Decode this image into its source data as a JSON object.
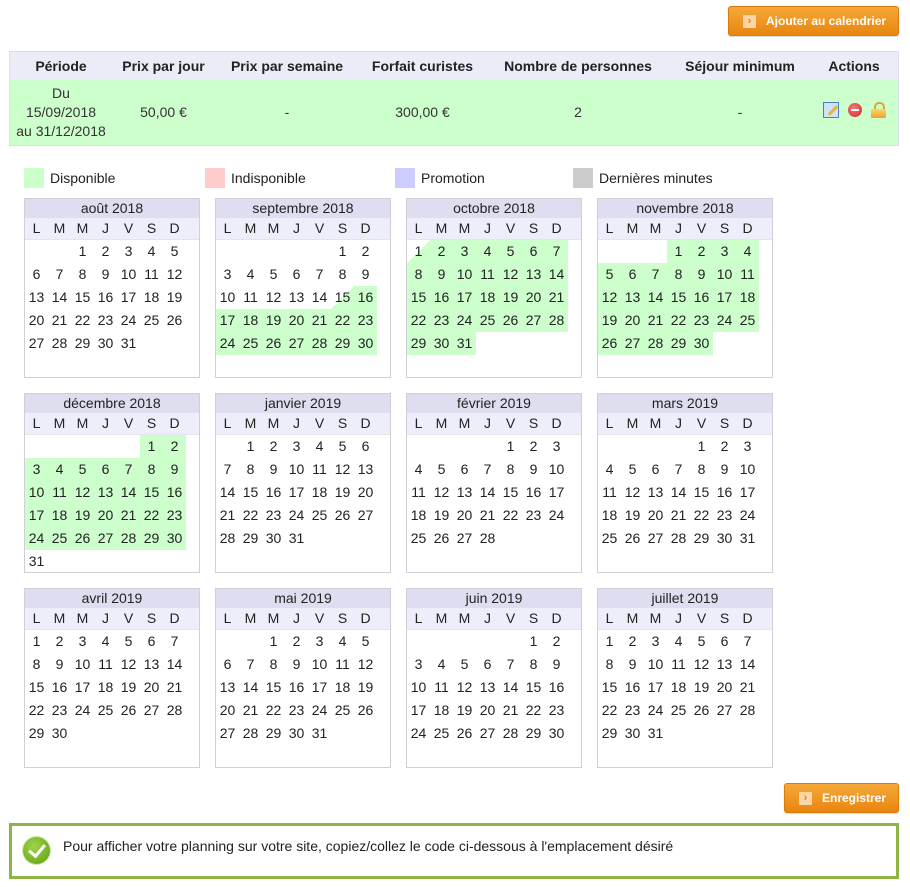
{
  "toolbar": {
    "add_calendar_label": "Ajouter au calendrier",
    "save_label": "Enregistrer",
    "chevron_icon": "chevron-right-icon"
  },
  "table": {
    "headers": [
      "Période",
      "Prix par jour",
      "Prix par semaine",
      "Forfait curistes",
      "Nombre de personnes",
      "Séjour minimum",
      "Actions"
    ],
    "rows": [
      {
        "period_line1": "Du",
        "period_line2": "15/09/2018",
        "period_line3": "au 31/12/2018",
        "price_day": "50,00 €",
        "price_week": "-",
        "forfait_curistes": "300,00 €",
        "persons": "2",
        "min_stay": "-",
        "actions": [
          "edit-icon",
          "delete-icon",
          "lock-icon"
        ]
      }
    ],
    "row_color": "#ccffcc"
  },
  "legend": [
    {
      "label": "Disponible",
      "color": "#ccffcc"
    },
    {
      "label": "Indisponible",
      "color": "#ffcccc"
    },
    {
      "label": "Promotion",
      "color": "#ccccff"
    },
    {
      "label": "Dernières minutes",
      "color": "#cccccc"
    }
  ],
  "weekdays": [
    "L",
    "M",
    "M",
    "J",
    "V",
    "S",
    "D"
  ],
  "months": [
    {
      "title": "août 2018",
      "first_weekday": 2,
      "days": 31,
      "available": [],
      "half_start": []
    },
    {
      "title": "septembre 2018",
      "first_weekday": 5,
      "days": 30,
      "available": [
        [
          16,
          30
        ]
      ],
      "half_start": [
        15
      ]
    },
    {
      "title": "octobre 2018",
      "first_weekday": 0,
      "days": 31,
      "available": [
        [
          2,
          31
        ]
      ],
      "half_start": [
        1
      ]
    },
    {
      "title": "novembre 2018",
      "first_weekday": 3,
      "days": 30,
      "available": [
        [
          1,
          30
        ]
      ],
      "half_start": []
    },
    {
      "title": "décembre 2018",
      "first_weekday": 5,
      "days": 31,
      "available": [
        [
          1,
          30
        ]
      ],
      "half_start": []
    },
    {
      "title": "janvier 2019",
      "first_weekday": 1,
      "days": 31,
      "available": [],
      "half_start": []
    },
    {
      "title": "février 2019",
      "first_weekday": 4,
      "days": 28,
      "available": [],
      "half_start": []
    },
    {
      "title": "mars 2019",
      "first_weekday": 4,
      "days": 31,
      "available": [],
      "half_start": []
    },
    {
      "title": "avril 2019",
      "first_weekday": 0,
      "days": 30,
      "available": [],
      "half_start": []
    },
    {
      "title": "mai 2019",
      "first_weekday": 2,
      "days": 31,
      "available": [],
      "half_start": []
    },
    {
      "title": "juin 2019",
      "first_weekday": 5,
      "days": 30,
      "available": [],
      "half_start": []
    },
    {
      "title": "juillet 2019",
      "first_weekday": 0,
      "days": 31,
      "available": [],
      "half_start": []
    }
  ],
  "message": {
    "icon": "check-icon",
    "text": "Pour afficher votre planning sur votre site, copiez/collez le code ci-dessous à l'emplacement désiré"
  }
}
